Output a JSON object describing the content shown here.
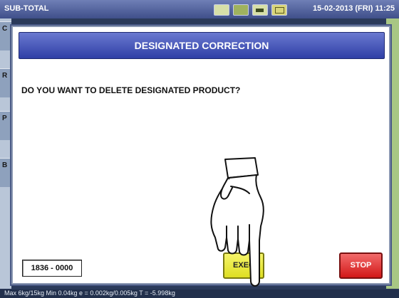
{
  "window": {
    "title": "SUB-TOTAL",
    "datetime": "15-02-2013 (FRI) 11:25"
  },
  "side_tabs": [
    "C",
    "R",
    "P",
    "B"
  ],
  "status_icons": [
    "printer-icon",
    "scale-icon",
    "battery-icon",
    "connection-icon"
  ],
  "dialog": {
    "title": "DESIGNATED CORRECTION",
    "question": "DO YOU WANT TO DELETE DESIGNATED PRODUCT?",
    "code": "1836 - 0000",
    "exec_label": "EXEC",
    "stop_label": "STOP"
  },
  "footer": {
    "scale_info": "Max 6kg/15kg  Min 0.04kg  e = 0.002kg/0.005kg  T = -5.998kg"
  },
  "colors": {
    "header": "#3f4fb0",
    "exec": "#eeee44",
    "stop": "#e23030"
  }
}
